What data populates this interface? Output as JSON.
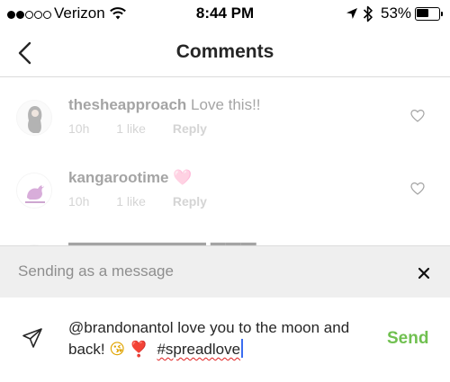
{
  "status_bar": {
    "carrier": "Verizon",
    "signal_bars_filled": 2,
    "signal_bars_total": 5,
    "time": "8:44 PM",
    "battery_percent": "53%",
    "battery_level": 0.53,
    "icons": [
      "wifi-icon",
      "location-arrow-icon",
      "bluetooth-icon",
      "battery-icon"
    ]
  },
  "nav": {
    "back_icon": "chevron-left-icon",
    "title": "Comments"
  },
  "comments": [
    {
      "username": "thesheapproach",
      "text": "Love this!!",
      "time": "10h",
      "likes": "1 like",
      "reply_label": "Reply"
    },
    {
      "username": "kangarootime",
      "text": "🩷",
      "time": "10h",
      "likes": "1 like",
      "reply_label": "Reply"
    }
  ],
  "banner": {
    "text": "Sending as a message",
    "close_icon": "close-icon"
  },
  "composer": {
    "icon": "direct-send-icon",
    "message_line1": "@brandonantol love you to the moon and",
    "message_line2_prefix": "back! ",
    "emoji_kiss": "😘",
    "emoji_heart": "❣️",
    "hashtag": "#spreadlove",
    "send_label": "Send"
  },
  "colors": {
    "send_green": "#70c050",
    "banner_bg": "#efefef",
    "caret_blue": "#3b6df0",
    "secondary_text": "#999999"
  }
}
